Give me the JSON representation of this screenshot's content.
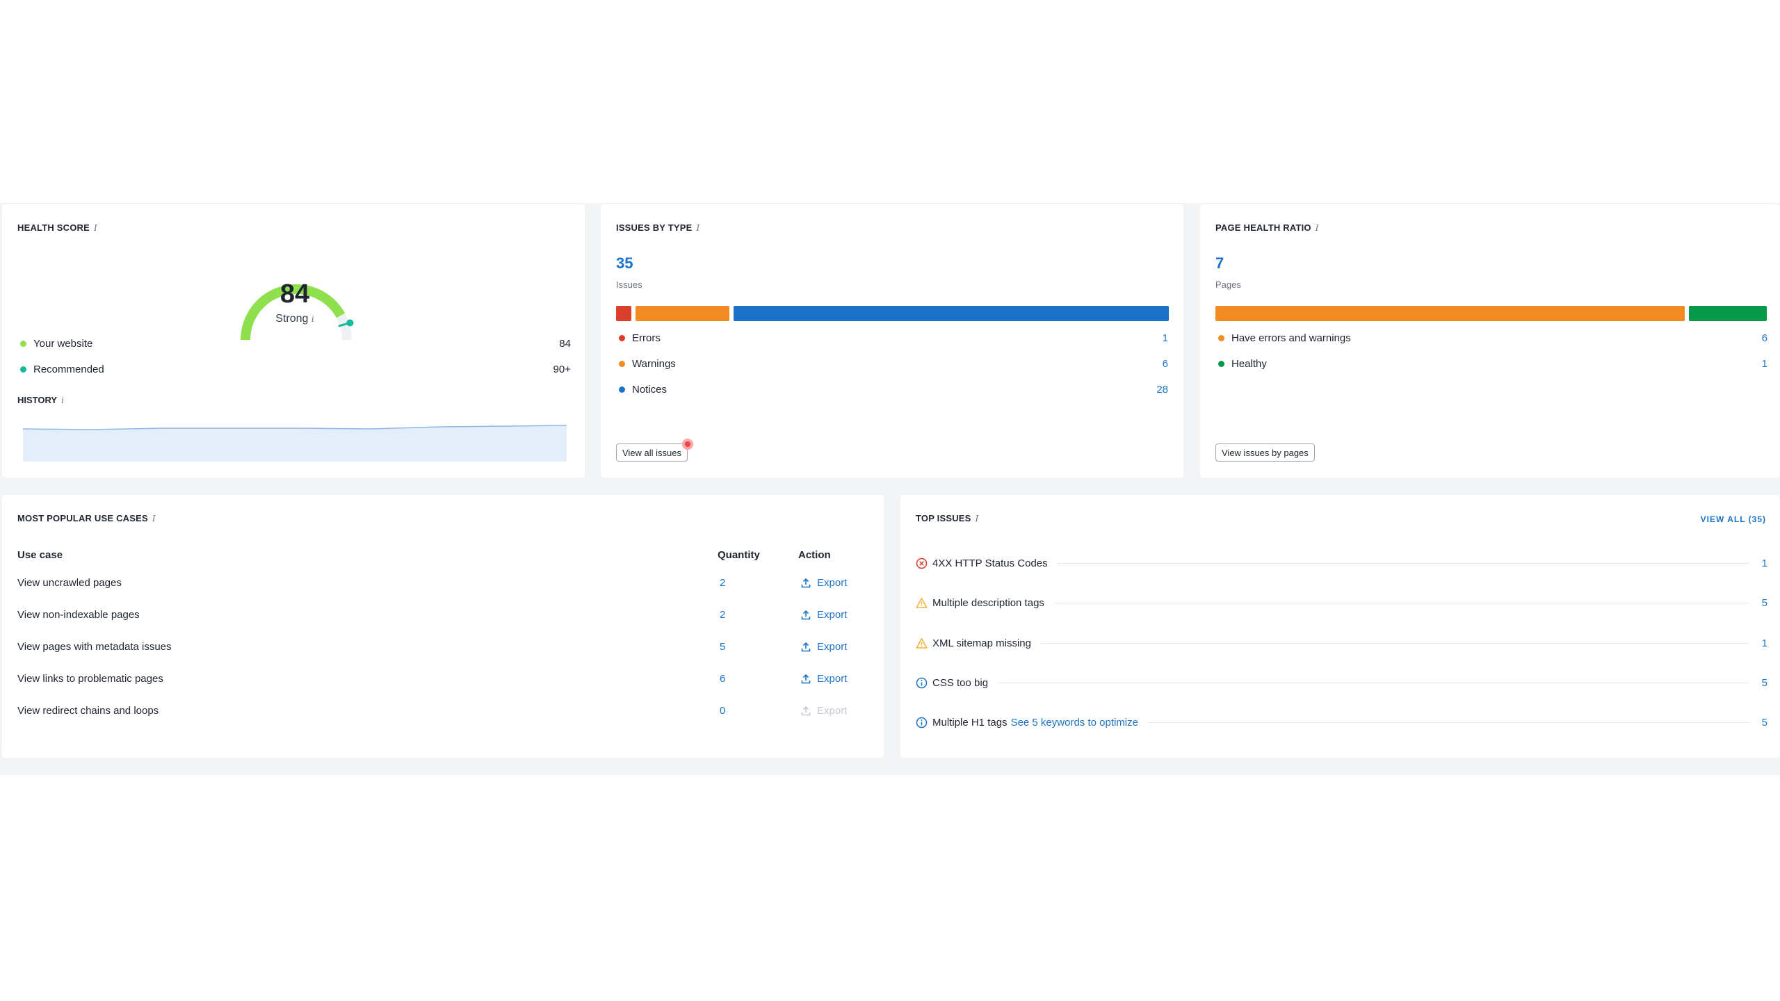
{
  "colors": {
    "accent": "#1a73c9",
    "errors": "#d93f2b",
    "warnings": "#f28b22",
    "notices": "#1a73c9",
    "healthy": "#049a4a",
    "gauge_green": "#8ee04d"
  },
  "health_score": {
    "title": "HEALTH SCORE",
    "score": "84",
    "score_value": 84,
    "label": "Strong",
    "legend": [
      {
        "label": "Your website",
        "value": "84",
        "color": "#8ee04d"
      },
      {
        "label": "Recommended",
        "value": "90+",
        "color": "#14b89a"
      }
    ],
    "history_title": "HISTORY"
  },
  "issues_by_type": {
    "title": "ISSUES BY TYPE",
    "total": "35",
    "total_label": "Issues",
    "rows": [
      {
        "label": "Errors",
        "value": "1",
        "count": 1,
        "color": "#d93f2b"
      },
      {
        "label": "Warnings",
        "value": "6",
        "count": 6,
        "color": "#f28b22"
      },
      {
        "label": "Notices",
        "value": "28",
        "count": 28,
        "color": "#1a73c9"
      }
    ],
    "button": "View all issues"
  },
  "page_health_ratio": {
    "title": "PAGE HEALTH RATIO",
    "total": "7",
    "total_label": "Pages",
    "rows": [
      {
        "label": "Have errors and warnings",
        "value": "6",
        "count": 6,
        "color": "#f28b22"
      },
      {
        "label": "Healthy",
        "value": "1",
        "count": 1,
        "color": "#049a4a"
      }
    ],
    "button": "View issues by pages"
  },
  "use_cases": {
    "title": "MOST POPULAR USE CASES",
    "headers": {
      "use_case": "Use case",
      "quantity": "Quantity",
      "action": "Action"
    },
    "rows": [
      {
        "name": "View uncrawled pages",
        "quantity": "2",
        "action": "Export",
        "enabled": true
      },
      {
        "name": "View non-indexable pages",
        "quantity": "2",
        "action": "Export",
        "enabled": true
      },
      {
        "name": "View pages with metadata issues",
        "quantity": "5",
        "action": "Export",
        "enabled": true
      },
      {
        "name": "View links to problematic pages",
        "quantity": "6",
        "action": "Export",
        "enabled": true
      },
      {
        "name": "View redirect chains and loops",
        "quantity": "0",
        "action": "Export",
        "enabled": false
      }
    ]
  },
  "top_issues": {
    "title": "TOP ISSUES",
    "view_all": "VIEW ALL (35)",
    "rows": [
      {
        "icon": "error-circle-icon",
        "label": "4XX HTTP Status Codes",
        "link": "",
        "value": "1"
      },
      {
        "icon": "warning-triangle-icon",
        "label": "Multiple description tags",
        "link": "",
        "value": "5"
      },
      {
        "icon": "warning-triangle-icon",
        "label": "XML sitemap missing",
        "link": "",
        "value": "1"
      },
      {
        "icon": "info-circle-icon",
        "label": "CSS too big",
        "link": "",
        "value": "5"
      },
      {
        "icon": "info-circle-icon",
        "label": "Multiple H1 tags",
        "link": "See 5 keywords to optimize",
        "value": "5"
      }
    ]
  }
}
